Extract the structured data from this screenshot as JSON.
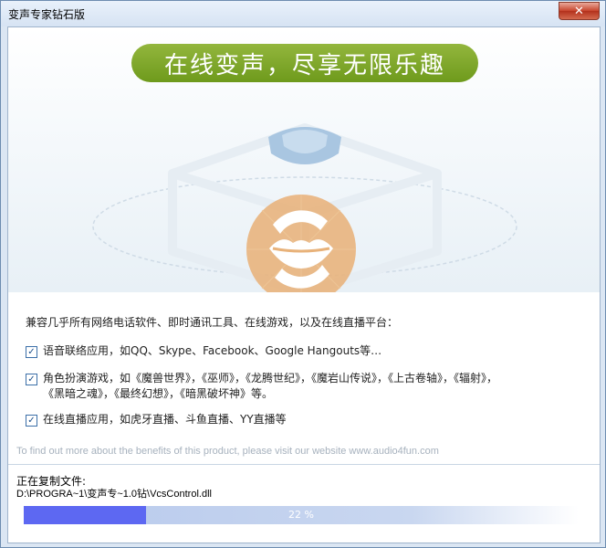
{
  "window": {
    "title": "变声专家钻石版",
    "close_symbol": "✕"
  },
  "hero": {
    "banner_text": "在线变声，尽享无限乐趣",
    "logo_icon": "lips-logo-icon"
  },
  "features": {
    "intro": "兼容几乎所有网络电话软件、即时通讯工具、在线游戏，以及在线直播平台：",
    "items": [
      {
        "lines": [
          "语音联络应用，如QQ、Skype、Facebook、Google Hangouts等…"
        ],
        "checked": true
      },
      {
        "lines": [
          "角色扮演游戏，如《魔兽世界》，《巫师》，《龙腾世纪》，《魔岩山传说》，《上古卷轴》，《辐射》，",
          "《黑暗之魂》，《最终幻想》，《暗黑破坏神》等。"
        ],
        "checked": true
      },
      {
        "lines": [
          "在线直播应用，如虎牙直播、斗鱼直播、YY直播等"
        ],
        "checked": true
      }
    ],
    "more_info": "To find out more about the benefits of this product, please visit our website www.audio4fun.com"
  },
  "status": {
    "label": "正在复制文件:",
    "path": "D:\\PROGRA~1\\变声专~1.0钻\\VcsControl.dll",
    "progress_value": 22,
    "progress_text": "22 %"
  },
  "colors": {
    "banner": "#7fa62a",
    "progress_fill": "#5d68f2",
    "logo": "#e8b27a"
  }
}
